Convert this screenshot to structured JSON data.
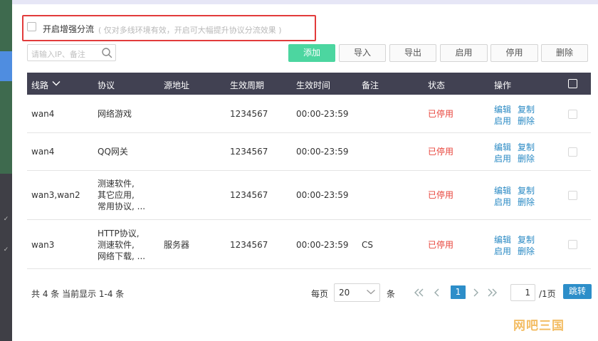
{
  "option": {
    "label": "开启增强分流",
    "hint": "( 仅对多线环境有效，开启可大幅提升协议分流效果 )"
  },
  "search": {
    "placeholder": "请输入IP、备注"
  },
  "toolbar": {
    "add": "添加",
    "import": "导入",
    "export": "导出",
    "enable": "启用",
    "disable": "停用",
    "delete": "删除"
  },
  "table": {
    "headers": {
      "line": "线路",
      "protocol": "协议",
      "source": "源地址",
      "period": "生效周期",
      "time": "生效时间",
      "remark": "备注",
      "status": "状态",
      "ops": "操作"
    },
    "rows": [
      {
        "line": "wan4",
        "protocol": [
          "网络游戏"
        ],
        "source": "",
        "period": "1234567",
        "time": "00:00-23:59",
        "remark": "",
        "status": "已停用"
      },
      {
        "line": "wan4",
        "protocol": [
          "QQ网关"
        ],
        "source": "",
        "period": "1234567",
        "time": "00:00-23:59",
        "remark": "",
        "status": "已停用"
      },
      {
        "line": "wan3,wan2",
        "protocol": [
          "测速软件,",
          "其它应用,",
          "常用协议, ..."
        ],
        "source": "",
        "period": "1234567",
        "time": "00:00-23:59",
        "remark": "",
        "status": "已停用"
      },
      {
        "line": "wan3",
        "protocol": [
          "HTTP协议,",
          "测速软件,",
          "网络下载, ..."
        ],
        "source": "服务器",
        "period": "1234567",
        "time": "00:00-23:59",
        "remark": "CS",
        "status": "已停用"
      }
    ],
    "row_ops": {
      "edit": "编辑",
      "copy": "复制",
      "enable": "启用",
      "delete": "删除"
    }
  },
  "pager": {
    "total": "共 4 条 当前显示 1-4 条",
    "per_page_label": "每页",
    "per_page_value": "20",
    "per_page_unit": "条",
    "current_page": "1",
    "page_input": "1",
    "total_pages": "/1页",
    "jump": "跳转"
  },
  "watermark": "网吧三国",
  "colors": {
    "primary_button": "#4cd6a0",
    "header_bg": "#414152",
    "status_disabled": "#e8453c",
    "link": "#2a8ac4",
    "pager_active": "#2d8ec9",
    "highlight_border": "#e23b3b"
  }
}
